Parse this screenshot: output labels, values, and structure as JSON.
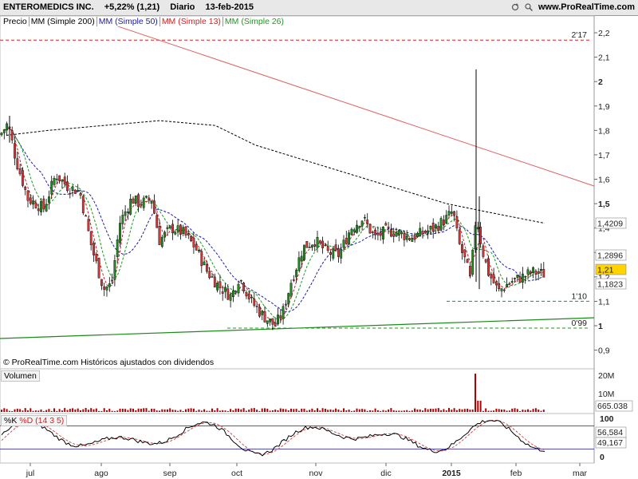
{
  "header": {
    "symbol": "ENTEROMEDICS INC.",
    "change": "+5,22% (1,21)",
    "period": "Diario",
    "date": "13-feb-2015",
    "site": "www.ProRealTime.com"
  },
  "legend": {
    "price": "Precio",
    "ma200": "MM (Simple 200)",
    "ma50": "MM (Simple 50)",
    "ma13": "MM (Simple 13)",
    "ma26": "MM (Simple 26)"
  },
  "copyright": "© ProRealTime.com Históricos ajustados con dividendos",
  "colors": {
    "up": "#1e8c1e",
    "down": "#d23a3a",
    "ma200": "#000000",
    "ma50": "#1a1aa8",
    "ma13": "#d81e1e",
    "ma26": "#1a9a1a",
    "volume": "#b20000"
  },
  "price_axis": {
    "ticks": [
      "2,2",
      "2,1",
      "2",
      "1,9",
      "1,8",
      "1,7",
      "1,6",
      "1,5",
      "1,4",
      "1,3",
      "1,2",
      "1,1",
      "1",
      "0,9"
    ],
    "badges": [
      {
        "text": "1,4209",
        "value": 1.4209,
        "bg": "#ffffff",
        "fg": "#000000",
        "border": "#888888"
      },
      {
        "text": "1,2896",
        "value": 1.2896,
        "bg": "#ffffff",
        "fg": "#000000",
        "border": "#888888"
      },
      {
        "text": "1,21",
        "value": 1.21,
        "bg": "#ffd400",
        "fg": "#000000",
        "border": "#888888"
      },
      {
        "text": "1,1823",
        "value": 1.1823,
        "bg": "#ffffff",
        "fg": "#d81e1e",
        "border": "#888888"
      }
    ],
    "levels": [
      {
        "label": "2'17",
        "value": 2.17,
        "color": "#d81e1e"
      },
      {
        "label": "1'10",
        "value": 1.1,
        "color": "#1a9a1a"
      },
      {
        "label": "0'99",
        "value": 0.99,
        "color": "#1a9a1a"
      }
    ]
  },
  "volume": {
    "label": "Volumen",
    "ticks": [
      "20M",
      "10M"
    ],
    "last": "665.038"
  },
  "stoch": {
    "label_k": "%K",
    "label_d": "%D (14 3 5)",
    "ticks": [
      "100",
      "50",
      "0"
    ],
    "value_d": "56,584",
    "value_k": "49,167"
  },
  "time_axis": {
    "labels": [
      "jul",
      "ago",
      "sep",
      "oct",
      "nov",
      "dic",
      "2015",
      "feb",
      "mar"
    ]
  },
  "chart_data": {
    "type": "candlestick",
    "title": "ENTEROMEDICS INC.",
    "period": "Diario",
    "date": "13-feb-2015",
    "ylim": [
      0.85,
      2.25
    ],
    "last_close": 1.21,
    "change_pct": 5.22,
    "ma_values": {
      "MM (Simple 200)": 1.4209,
      "MM (Simple 50)": 1.2896,
      "MM (Simple 13)": 1.1823
    },
    "volume_last": 665038,
    "stochastic": {
      "K": 49.167,
      "D": 56.584,
      "params": "14 3 5"
    }
  }
}
